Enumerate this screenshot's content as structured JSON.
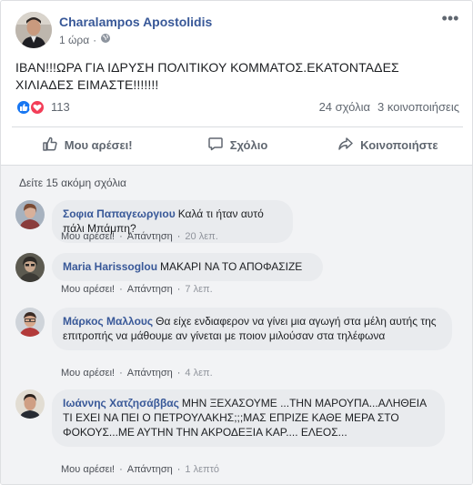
{
  "post": {
    "author": "Charalampos Apostolidis",
    "time": "1 ώρα",
    "privacy_icon": "globe-icon",
    "text": "ΙΒΑΝ!!!ΩΡΑ ΓΙΑ ΙΔΡΥΣΗ ΠΟΛΙΤΙΚΟΥ ΚΟΜΜΑΤΟΣ.ΕΚΑΤΟΝΤΑΔΕΣ ΧΙΛΙΑΔΕΣ ΕΙΜΑΣΤΕ!!!!!!!",
    "reactions_count": "113",
    "comments_count": "24 σχόλια",
    "shares_count": "3 κοινοποιήσεις"
  },
  "actions": {
    "like": "Μου αρέσει!",
    "comment": "Σχόλιο",
    "share": "Κοινοποιήστε"
  },
  "comments_section": {
    "view_more": "Δείτε 15 ακόμη σχόλια",
    "like_label": "Μου αρέσει!",
    "reply_label": "Απάντηση",
    "items": [
      {
        "name": "Σοφια Παπαγεωργιου",
        "text": "Καλά τι ήταν αυτό πάλι Μπάμπη?",
        "time": "20 λεπ."
      },
      {
        "name": "Maria Harissoglou",
        "text": "ΜΑΚΑΡΙ ΝΑ ΤΟ ΑΠΟΦΑΣΙΖΕ",
        "time": "7 λεπ."
      },
      {
        "name": "Μάρκος Μαλλους",
        "text": "Θα είχε ενδιαφερον να γίνει μια αγωγή στα μέλη αυτής της επιτροπής να μάθουμε αν γίνεται με ποιον μιλούσαν στα τηλέφωνα",
        "time": "4 λεπ."
      },
      {
        "name": "Ιωάννης Χατζησάββας",
        "text": "ΜΗΝ ΞΕΧΑΣΟΥΜΕ ...ΤΗΝ ΜΑΡΟΥΠΑ...ΑΛΗΘΕΙΑ ΤΙ ΕΧΕΙ ΝΑ ΠΕΙ Ο ΠΕΤΡΟΥΛΑΚΗΣ;;;ΜΑΣ ΕΠΡΙΖΕ ΚΑΘΕ ΜΕΡΑ ΣΤΟ ΦΟΚΟΥΣ...ΜΕ ΑΥΤΗΝ ΤΗΝ ΑΚΡΟΔΕΞΙΑ ΚΑΡ.... ΕΛΕΟΣ...",
        "time": "1 λεπτό"
      }
    ]
  },
  "colors": {
    "link": "#385898",
    "like_blue": "#1877f2",
    "love_red": "#f33e58",
    "muted": "#606770"
  }
}
